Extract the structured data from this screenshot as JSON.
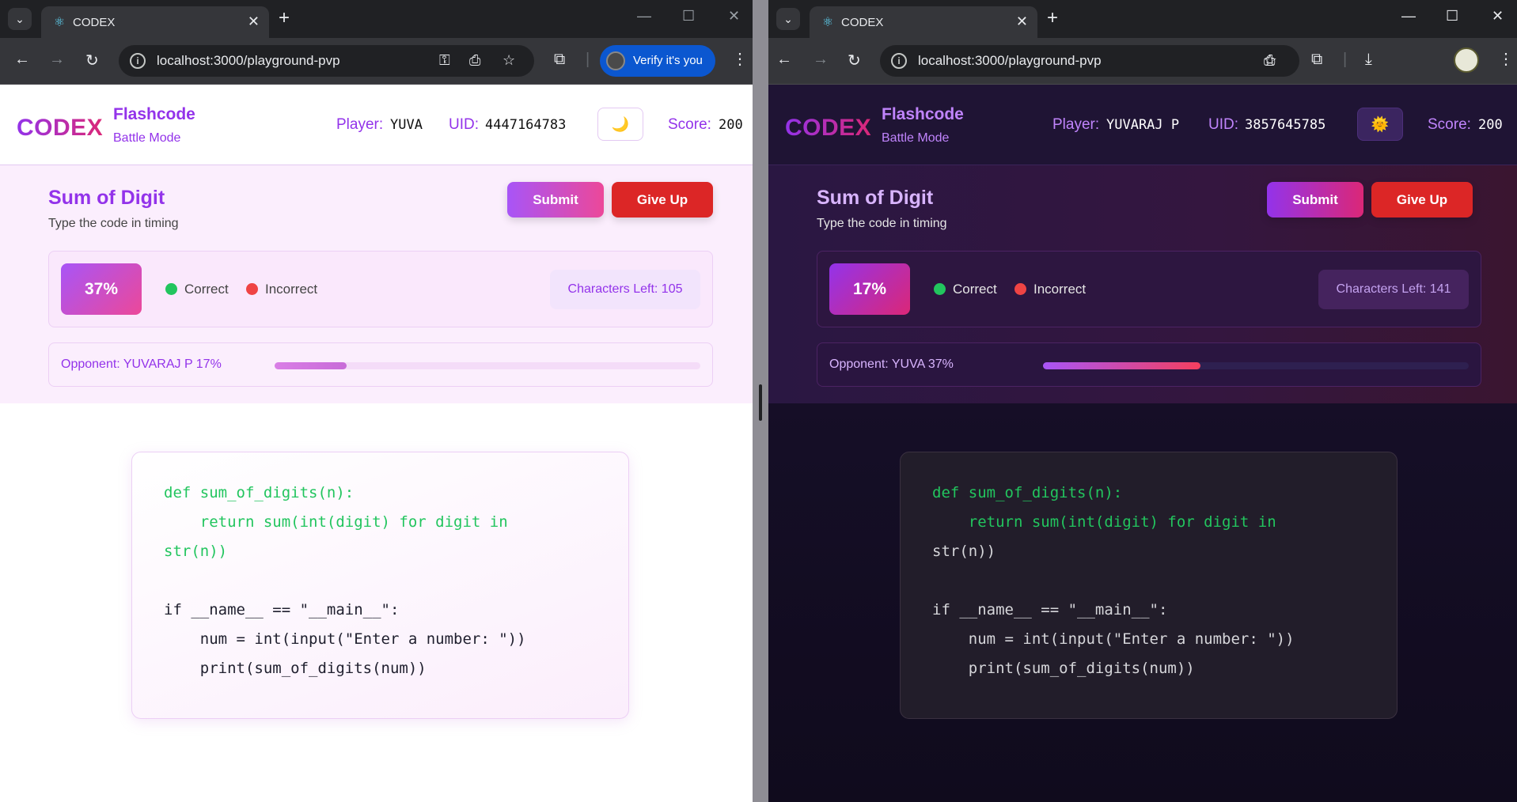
{
  "windows": [
    {
      "id": "left",
      "browser": {
        "tab_title": "CODEX",
        "url": "localhost:3000/playground-pvp",
        "verify_label": "Verify it's you",
        "theme_icon": "moon-icon"
      },
      "header": {
        "logo": "CODEX",
        "brand": "Flashcode",
        "mode": "Battle Mode",
        "player_label": "Player:",
        "player": "YUVA",
        "uid_label": "UID:",
        "uid": "4447164783",
        "theme_glyph": "🌙",
        "score_label": "Score:",
        "score": "200"
      },
      "problem": {
        "title": "Sum of Digit",
        "subtitle": "Type the code in timing",
        "submit_label": "Submit",
        "giveup_label": "Give Up"
      },
      "stats": {
        "progress_label": "37%",
        "progress": 0.37,
        "correct_label": "Correct",
        "incorrect_label": "Incorrect",
        "chars_left_label": "Characters Left: 105"
      },
      "opponent": {
        "label": "Opponent: YUVARAJ P  17%",
        "progress": 0.17
      },
      "code": {
        "lines": [
          "def sum_of_digits(n):",
          "    return sum(int(digit) for digit in",
          "str(n))",
          "",
          "if __name__ == \"__main__\":",
          "    num = int(input(\"Enter a number: \"))",
          "    print(sum_of_digits(num))"
        ],
        "typed_lines": 3
      },
      "colors": {
        "accent": "#9333ea",
        "accent2": "#ec4899",
        "correct": "#22c55e",
        "incorrect": "#ef4444",
        "danger": "#dc2626"
      }
    },
    {
      "id": "right",
      "browser": {
        "tab_title": "CODEX",
        "url": "localhost:3000/playground-pvp",
        "theme_icon": "sun-icon"
      },
      "header": {
        "logo": "CODEX",
        "brand": "Flashcode",
        "mode": "Battle Mode",
        "player_label": "Player:",
        "player": "YUVARAJ P",
        "uid_label": "UID:",
        "uid": "3857645785",
        "theme_glyph": "🌞",
        "score_label": "Score:",
        "score": "200"
      },
      "problem": {
        "title": "Sum of Digit",
        "subtitle": "Type the code in timing",
        "submit_label": "Submit",
        "giveup_label": "Give Up"
      },
      "stats": {
        "progress_label": "17%",
        "progress": 0.17,
        "correct_label": "Correct",
        "incorrect_label": "Incorrect",
        "chars_left_label": "Characters Left: 141"
      },
      "opponent": {
        "label": "Opponent: YUVA  37%",
        "progress": 0.37
      },
      "code": {
        "lines": [
          "def sum_of_digits(n):",
          "    return sum(int(digit) for digit in",
          "str(n))",
          "",
          "if __name__ == \"__main__\":",
          "    num = int(input(\"Enter a number: \"))",
          "    print(sum_of_digits(num))"
        ],
        "typed_lines": 2
      },
      "colors": {
        "accent": "#c084fc",
        "accent2": "#db2777",
        "correct": "#22c55e",
        "incorrect": "#ef4444",
        "danger": "#dc2626"
      }
    }
  ]
}
